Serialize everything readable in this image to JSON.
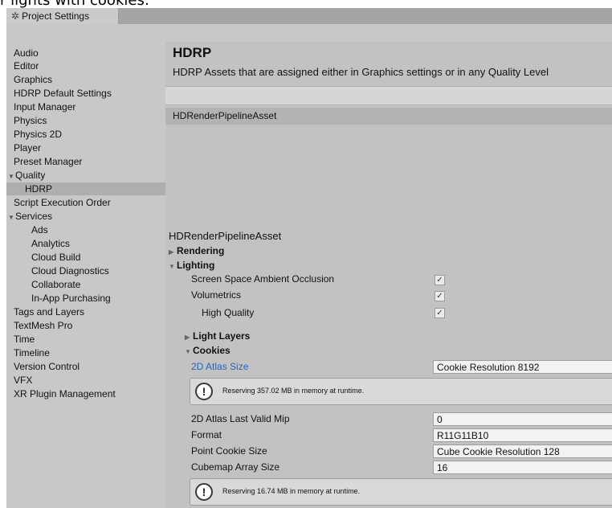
{
  "top_caption": "r lights with cookies:",
  "window": {
    "tab_label": "Project Settings"
  },
  "sidebar": {
    "items": [
      {
        "label": "Audio"
      },
      {
        "label": "Editor"
      },
      {
        "label": "Graphics"
      },
      {
        "label": "HDRP Default Settings"
      },
      {
        "label": "Input Manager"
      },
      {
        "label": "Physics"
      },
      {
        "label": "Physics 2D"
      },
      {
        "label": "Player"
      },
      {
        "label": "Preset Manager"
      },
      {
        "label": "Quality"
      },
      {
        "label": "HDRP"
      },
      {
        "label": "Script Execution Order"
      },
      {
        "label": "Services"
      },
      {
        "label": "Ads"
      },
      {
        "label": "Analytics"
      },
      {
        "label": "Cloud Build"
      },
      {
        "label": "Cloud Diagnostics"
      },
      {
        "label": "Collaborate"
      },
      {
        "label": "In-App Purchasing"
      },
      {
        "label": "Tags and Layers"
      },
      {
        "label": "TextMesh Pro"
      },
      {
        "label": "Time"
      },
      {
        "label": "Timeline"
      },
      {
        "label": "Version Control"
      },
      {
        "label": "VFX"
      },
      {
        "label": "XR Plugin Management"
      }
    ]
  },
  "main": {
    "title": "HDRP",
    "subtitle": "HDRP Assets that are assigned either in Graphics settings or in any Quality Level",
    "asset_row": "HDRenderPipelineAsset",
    "inspector_title": "HDRenderPipelineAsset",
    "sections": {
      "rendering": "Rendering",
      "lighting": "Lighting",
      "light_layers": "Light Layers",
      "cookies": "Cookies"
    },
    "lighting_props": {
      "ssao": "Screen Space Ambient Occlusion",
      "volumetrics": "Volumetrics",
      "high_quality": "High Quality"
    },
    "check_glyph": "✓",
    "cookies": {
      "atlas_size_label": "2D Atlas Size",
      "atlas_size_value": "Cookie Resolution 8192",
      "help1": "Reserving 357.02 MB in memory at runtime.",
      "last_mip_label": "2D Atlas Last Valid Mip",
      "last_mip_value": "0",
      "format_label": "Format",
      "format_value": "R11G11B10",
      "point_size_label": "Point Cookie Size",
      "point_size_value": "Cube Cookie Resolution 128",
      "cubemap_label": "Cubemap Array Size",
      "cubemap_value": "16",
      "help2": "Reserving 16.74 MB in memory at runtime.",
      "warn_glyph": "!"
    }
  },
  "icons": {
    "settings": "gear-icon",
    "expand": "triangle-icon",
    "warning": "warning-icon"
  },
  "colors": {
    "link": "#1f63c9",
    "panel": "#c2c2c2",
    "selected": "#aeaeae"
  }
}
